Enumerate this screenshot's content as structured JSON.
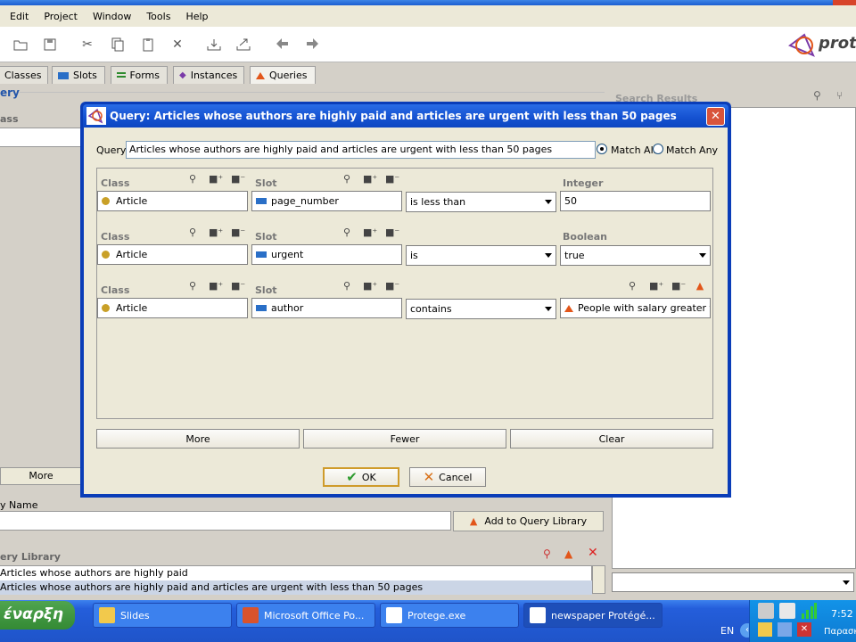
{
  "menu": [
    "Edit",
    "Project",
    "Window",
    "Tools",
    "Help"
  ],
  "logo_text": "proté",
  "tabs": [
    {
      "label": "Classes",
      "color": "#c9a027"
    },
    {
      "label": "Slots",
      "color": "#2a6fc7"
    },
    {
      "label": "Forms",
      "color": "#2e8b2e"
    },
    {
      "label": "Instances",
      "color": "#7a3aa8"
    },
    {
      "label": "Queries",
      "color": "#e2561a"
    }
  ],
  "left_panel": {
    "query_label": "ery",
    "class_label": "ass",
    "more_label": "More",
    "query_name_label": "y Name",
    "add_to_library_label": "Add to Query Library",
    "library_label": "ery Library",
    "library_items": [
      "Articles whose authors are highly paid",
      "Articles whose authors are highly paid and articles are urgent with less than 50 pages"
    ]
  },
  "right_panel": {
    "search_results_label": "Search Results"
  },
  "dialog": {
    "title": "Query: Articles whose authors are highly paid and articles are urgent with less than 50 pages",
    "query_label": "Query:",
    "query_value": "Articles whose authors are highly paid and articles are urgent with less than 50 pages",
    "match_all": "Match All",
    "match_any": "Match Any",
    "rows": [
      {
        "class_label": "Class",
        "class_value": "Article",
        "slot_label": "Slot",
        "slot_value": "page_number",
        "op": "is less than",
        "value_label": "Integer",
        "value": "50"
      },
      {
        "class_label": "Class",
        "class_value": "Article",
        "slot_label": "Slot",
        "slot_value": "urgent",
        "op": "is",
        "value_label": "Boolean",
        "value": "true"
      },
      {
        "class_label": "Class",
        "class_value": "Article",
        "slot_label": "Slot",
        "slot_value": "author",
        "op": "contains",
        "value_label": "",
        "value": "People with salary greater th···"
      }
    ],
    "more_label": "More",
    "fewer_label": "Fewer",
    "clear_label": "Clear",
    "ok_label": "OK",
    "cancel_label": "Cancel"
  },
  "taskbar": {
    "start_label": "έναρξη",
    "tasks": [
      "Slides",
      "Microsoft Office Po...",
      "Protege.exe",
      "newspaper  Protégé..."
    ],
    "lang": "EN",
    "clock": "7:52",
    "tray_text": "Παρασκ"
  }
}
